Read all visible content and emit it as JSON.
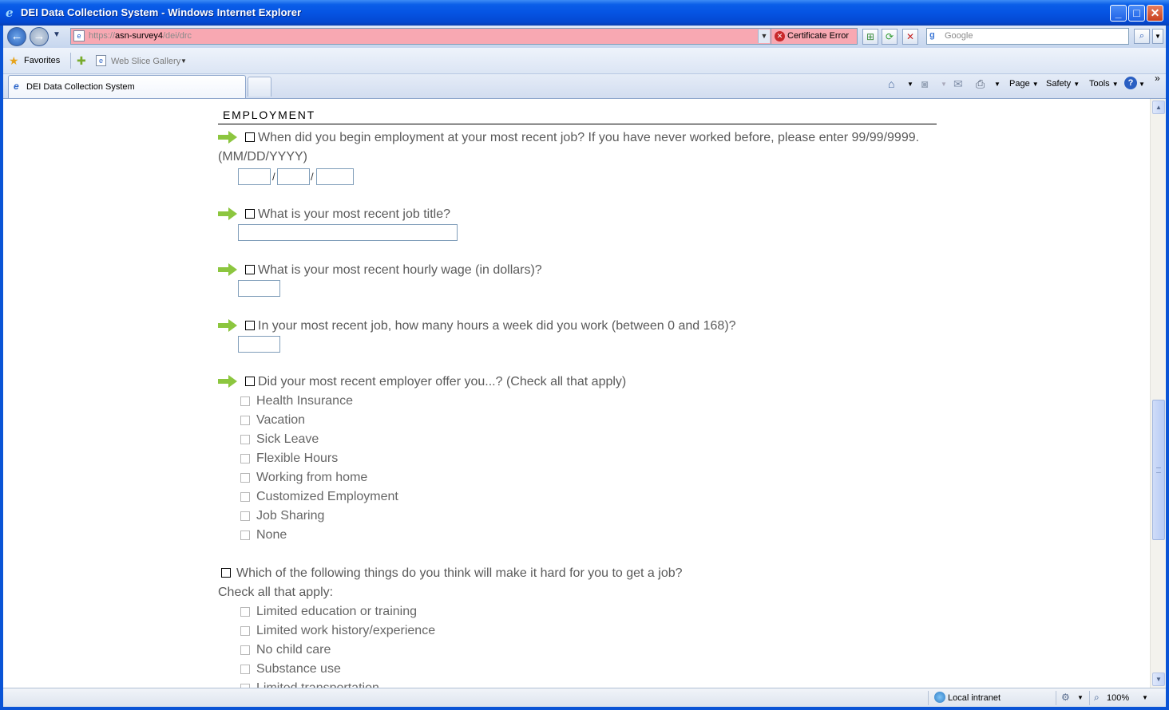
{
  "window": {
    "title": "DEI Data Collection System - Windows Internet Explorer"
  },
  "address_bar": {
    "url_prefix": "https://",
    "url_host": "asn-survey4",
    "url_path": "/dei/drc",
    "cert_error_label": "Certificate Error"
  },
  "search": {
    "placeholder": "Google"
  },
  "favorites_bar": {
    "favorites_label": "Favorites",
    "web_slice_label": "Web Slice Gallery"
  },
  "tabs": [
    {
      "label": "DEI Data Collection System"
    }
  ],
  "command_bar": {
    "page_label": "Page",
    "safety_label": "Safety",
    "tools_label": "Tools"
  },
  "survey": {
    "section_title": "EMPLOYMENT",
    "questions": {
      "start_date": {
        "text_line1": "When did you begin employment at your most recent job? If you have never worked before, please enter 99/99/9999.",
        "text_line2": "(MM/DD/YYYY)",
        "separator": "/"
      },
      "job_title": {
        "text": "What is your most recent job title?"
      },
      "hourly_wage": {
        "text": "What is your most recent hourly wage (in dollars)?"
      },
      "hours_week": {
        "text": "In your most recent job, how many hours a week did you work (between 0 and 168)?"
      },
      "benefits": {
        "text": "Did your most recent employer offer you...? (Check all that apply)",
        "options": [
          "Health Insurance",
          "Vacation",
          "Sick Leave",
          "Flexible Hours",
          "Working from home",
          "Customized Employment",
          "Job Sharing",
          "None"
        ]
      },
      "barriers": {
        "text": "Which of the following things do you think will make it hard for you to get a job?",
        "subtext": "Check all that apply:",
        "options": [
          "Limited education or training",
          "Limited work history/experience",
          "No child care",
          "Substance use",
          "Limited transportation"
        ]
      }
    }
  },
  "status_bar": {
    "zone": "Local intranet",
    "zoom": "100%"
  },
  "colors": {
    "title_bar": "#0554e3",
    "cert_error_bg": "#f8a8b2",
    "arrow_green": "#8cc63f",
    "question_text": "#5a5a5a"
  }
}
